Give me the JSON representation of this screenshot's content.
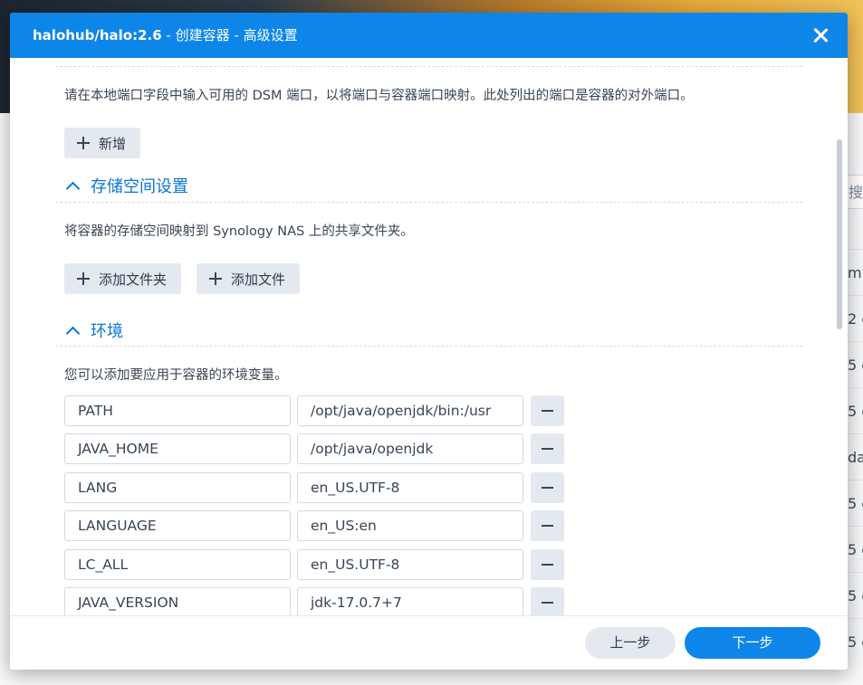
{
  "background": {
    "search_placeholder": "搜",
    "row_fragments": [
      "m",
      "2 c",
      "5 c",
      "5 c",
      "da",
      "5 c",
      "5 c",
      "5 c",
      "5 c"
    ]
  },
  "dialog": {
    "title_app": "halohub/halo:2.6",
    "title_separator_1": " - ",
    "title_step": "创建容器",
    "title_separator_2": " - ",
    "title_page": "高级设置"
  },
  "ports": {
    "description": "请在本地端口字段中输入可用的 DSM 端口，以将端口与容器端口映射。此处列出的端口是容器的对外端口。",
    "add_label": "新增"
  },
  "storage": {
    "section_title": "存储空间设置",
    "description": "将容器的存储空间映射到 Synology NAS 上的共享文件夹。",
    "add_folder_label": "添加文件夹",
    "add_file_label": "添加文件"
  },
  "environment": {
    "section_title": "环境",
    "description": "您可以添加要应用于容器的环境变量。",
    "variables": [
      {
        "key": "PATH",
        "value": "/opt/java/openjdk/bin:/usr"
      },
      {
        "key": "JAVA_HOME",
        "value": "/opt/java/openjdk"
      },
      {
        "key": "LANG",
        "value": "en_US.UTF-8"
      },
      {
        "key": "LANGUAGE",
        "value": "en_US:en"
      },
      {
        "key": "LC_ALL",
        "value": "en_US.UTF-8"
      },
      {
        "key": "JAVA_VERSION",
        "value": "jdk-17.0.7+7"
      }
    ]
  },
  "footer": {
    "prev_label": "上一步",
    "next_label": "下一步"
  },
  "colors": {
    "accent": "#0e86e9",
    "section_title": "#0a74d8",
    "button_gray": "#e4e9f0"
  }
}
